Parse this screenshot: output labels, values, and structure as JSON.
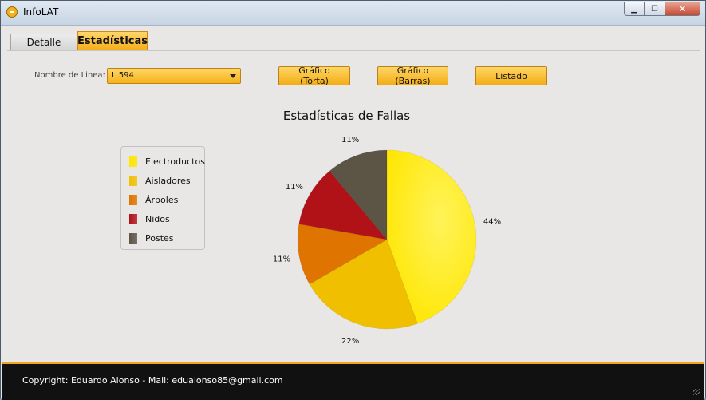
{
  "window": {
    "title": "InfoLAT",
    "icon": "infolat-app-icon",
    "controls": {
      "minimize": "▁",
      "maximize": "☐",
      "close": "✕"
    }
  },
  "tabs": [
    {
      "label": "Detalle",
      "active": false
    },
    {
      "label": "Estadísticas",
      "active": true
    }
  ],
  "toolbar": {
    "line_label": "Nombre de Linea:",
    "line_value": "L 594",
    "btn_torta": "Gráfico (Torta)",
    "btn_barras": "Gráfico (Barras)",
    "btn_listado": "Listado"
  },
  "chart_data": {
    "type": "pie",
    "title": "Estadísticas de Fallas",
    "legend_position": "left",
    "categories": [
      "Electroductos",
      "Aisladores",
      "Árboles",
      "Nidos",
      "Postes"
    ],
    "values": [
      44,
      22,
      11,
      11,
      11
    ],
    "value_labels": [
      "44%",
      "22%",
      "11%",
      "11%",
      "11%"
    ],
    "colors": [
      "#ffe600",
      "#f0c000",
      "#e07400",
      "#b01218",
      "#5c5444"
    ]
  },
  "footer": {
    "text": "Copyright: Eduardo Alonso - Mail: edualonso85@gmail.com"
  }
}
